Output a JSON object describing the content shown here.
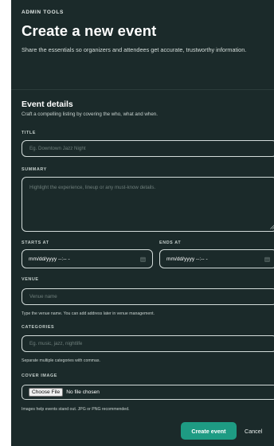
{
  "header": {
    "eyebrow": "ADMIN TOOLS",
    "title": "Create a new event",
    "description": "Share the essentials so organizers and attendees get accurate, trustworthy information."
  },
  "section": {
    "title": "Event details",
    "subtitle": "Craft a compelling listing by covering the who, what and when."
  },
  "form": {
    "title": {
      "label": "TITLE",
      "placeholder": "Eg. Downtown Jazz Night",
      "value": ""
    },
    "summary": {
      "label": "SUMMARY",
      "placeholder": "Highlight the experience, lineup or any must-know details.",
      "value": ""
    },
    "starts_at": {
      "label": "STARTS AT",
      "value": "mm/dd/yyyy --:-- -",
      "icon": "calendar-icon"
    },
    "ends_at": {
      "label": "ENDS AT",
      "value": "mm/dd/yyyy --:-- -",
      "icon": "calendar-icon"
    },
    "venue": {
      "label": "VENUE",
      "placeholder": "Venue name",
      "value": "",
      "help": "Type the venue name. You can add address later in venue management."
    },
    "categories": {
      "label": "CATEGORIES",
      "placeholder": "Eg. music, jazz, nightlife",
      "value": "",
      "help": "Separate multiple categories with commas."
    },
    "cover_image": {
      "label": "COVER IMAGE",
      "button": "Choose File",
      "status": "No file chosen",
      "help": "Images help events stand out. JPG or PNG recommended."
    }
  },
  "actions": {
    "submit": "Create event",
    "cancel": "Cancel"
  },
  "colors": {
    "background": "#1b2a2a",
    "accent": "#1e9b83",
    "border": "#d3dcda"
  }
}
